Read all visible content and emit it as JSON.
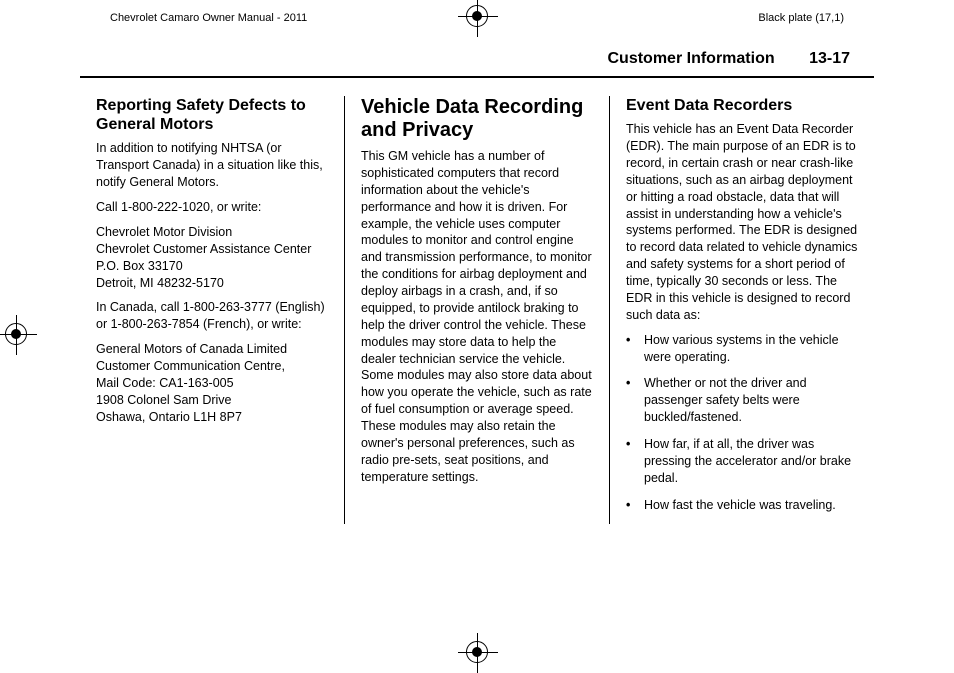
{
  "print": {
    "doc_title": "Chevrolet Camaro Owner Manual - 2011",
    "plate": "Black plate (17,1)"
  },
  "header": {
    "section": "Customer Information",
    "page": "13-17"
  },
  "col1": {
    "heading": "Reporting Safety Defects to General Motors",
    "p1": "In addition to notifying NHTSA (or Transport Canada) in a situation like this, notify General Motors.",
    "p2": "Call 1-800-222-1020, or write:",
    "addr1a": "Chevrolet Motor Division",
    "addr1b": "Chevrolet Customer Assistance Center",
    "addr1c": "P.O. Box 33170",
    "addr1d": "Detroit, MI  48232-5170",
    "p3": "In Canada, call 1-800-263-3777 (English) or 1-800-263-7854 (French), or write:",
    "addr2a": "General Motors of Canada Limited",
    "addr2b": "Customer Communication Centre,",
    "addr2c": "Mail Code: CA1-163-005",
    "addr2d": "1908 Colonel Sam Drive",
    "addr2e": "Oshawa, Ontario  L1H 8P7"
  },
  "col2": {
    "heading": "Vehicle Data Recording and Privacy",
    "p1": "This GM vehicle has a number of sophisticated computers that record information about the vehicle's performance and how it is driven. For example, the vehicle uses computer modules to monitor and control engine and transmission performance, to monitor the conditions for airbag deployment and deploy airbags in a crash, and, if so equipped, to provide antilock braking to help the driver control the vehicle. These modules may store data to help the dealer technician service the vehicle. Some modules may also store data about how you operate the vehicle, such as rate of fuel consumption or average speed. These modules may also retain the owner's personal preferences, such as radio pre-sets, seat positions, and temperature settings."
  },
  "col3": {
    "heading": "Event Data Recorders",
    "p1": "This vehicle has an Event Data Recorder (EDR). The main purpose of an EDR is to record, in certain crash or near crash-like situations, such as an airbag deployment or hitting a road obstacle, data that will assist in understanding how a vehicle's systems performed. The EDR is designed to record data related to vehicle dynamics and safety systems for a short period of time, typically 30 seconds or less. The EDR in this vehicle is designed to record such data as:",
    "bullets": [
      "How various systems in the vehicle were operating.",
      "Whether or not the driver and passenger safety belts were buckled/fastened.",
      "How far, if at all, the driver was pressing the accelerator and/or brake pedal.",
      "How fast the vehicle was traveling."
    ]
  }
}
